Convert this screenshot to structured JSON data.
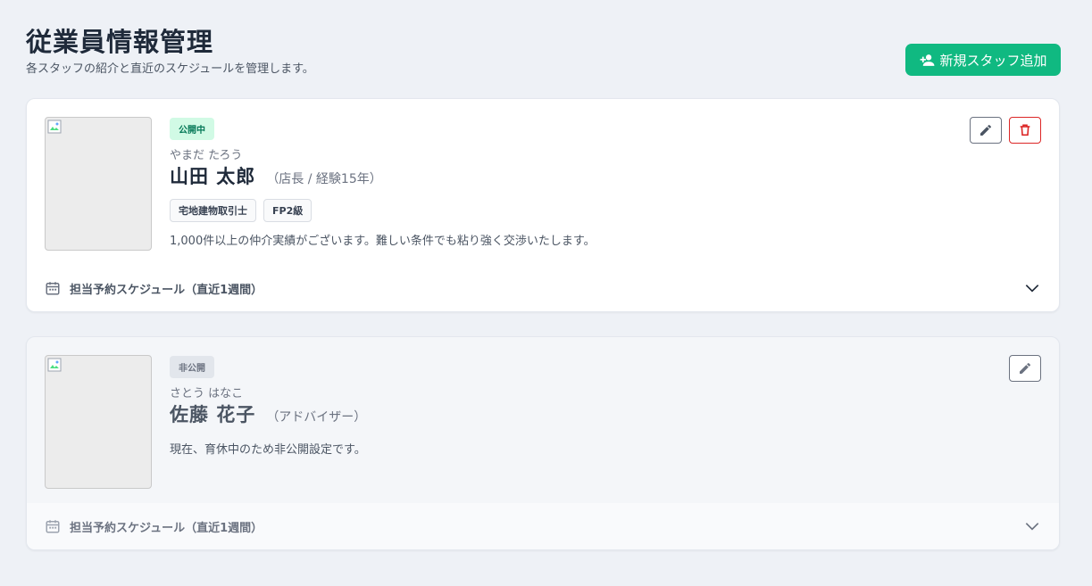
{
  "header": {
    "title": "従業員情報管理",
    "subtitle": "各スタッフの紹介と直近のスケジュールを管理します。",
    "add_button_label": "新規スタッフ追加",
    "add_button_icon": "user-plus-icon"
  },
  "colors": {
    "accent": "#10b981",
    "public_badge_bg": "#d1fae5",
    "public_badge_text": "#047857",
    "delete": "#dc2626"
  },
  "staff": [
    {
      "status": "公開中",
      "kana": "やまだ たろう",
      "name": "山田 太郎",
      "role": "（店長 / 経験15年）",
      "tags": [
        "宅地建物取引士",
        "FP2級"
      ],
      "description": "1,000件以上の仲介実績がございます。難しい条件でも粘り強く交渉いたします。",
      "schedule_label": "担当予約スケジュール（直近1週間）"
    },
    {
      "status": "非公開",
      "kana": "さとう はなこ",
      "name": "佐藤 花子",
      "role": "（アドバイザー）",
      "tags": [],
      "description": "現在、育休中のため非公開設定です。",
      "schedule_label": "担当予約スケジュール（直近1週間）"
    }
  ]
}
